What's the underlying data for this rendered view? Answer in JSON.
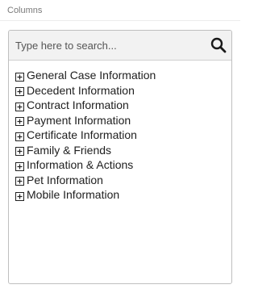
{
  "section": {
    "label": "Columns"
  },
  "search": {
    "placeholder": "Type here to search...",
    "value": ""
  },
  "tree": {
    "items": [
      {
        "label": "General Case Information",
        "icon": "plus-square-icon"
      },
      {
        "label": "Decedent Information",
        "icon": "plus-square-icon"
      },
      {
        "label": "Contract Information",
        "icon": "plus-square-icon"
      },
      {
        "label": "Payment Information",
        "icon": "plus-square-icon"
      },
      {
        "label": "Certificate Information",
        "icon": "plus-square-icon"
      },
      {
        "label": "Family & Friends",
        "icon": "plus-square-icon"
      },
      {
        "label": "Information & Actions",
        "icon": "plus-square-icon"
      },
      {
        "label": "Pet Information",
        "icon": "plus-square-icon"
      },
      {
        "label": "Mobile Information",
        "icon": "plus-square-icon"
      }
    ]
  },
  "colors": {
    "search_bar_bg": "#f2f2f2",
    "panel_border": "#bfbfbf",
    "label_muted": "#7a7a7a",
    "text": "#1e1e1e"
  }
}
